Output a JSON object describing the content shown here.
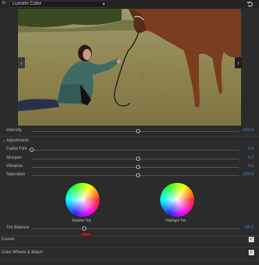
{
  "header": {
    "fx_label": "fx",
    "effect_name": "Lumetri Color",
    "caret": "▾",
    "reset_icon": "reset-icon"
  },
  "viewer": {
    "prev_arrow": "‹",
    "next_arrow": "›"
  },
  "intensity": {
    "label": "Intensity",
    "value": "100.0",
    "level_pct": 53
  },
  "adjustments": {
    "header": "Adjustments",
    "caret": "⌄",
    "rows": [
      {
        "label": "Faded Film",
        "value": "0.0",
        "level_pct": 0
      },
      {
        "label": "Sharpen",
        "value": "0.0",
        "level_pct": 50
      },
      {
        "label": "Vibrance",
        "value": "0.0",
        "level_pct": 50
      },
      {
        "label": "Saturation",
        "value": "100.0",
        "level_pct": 50
      }
    ]
  },
  "wheels": {
    "shadow_label": "Shadow Tint",
    "highlight_label": "Highlight Tint",
    "center_glyph": "+"
  },
  "tint_balance": {
    "label": "Tint Balance",
    "value": "-50.2",
    "level_pct": 25
  },
  "sections": [
    {
      "label": "Curves",
      "checked": true
    },
    {
      "label": "Color Wheels & Match",
      "checked": true
    }
  ],
  "check_glyph": "✓",
  "colors": {
    "accent": "#3d8eda",
    "marker": "#e00000"
  }
}
